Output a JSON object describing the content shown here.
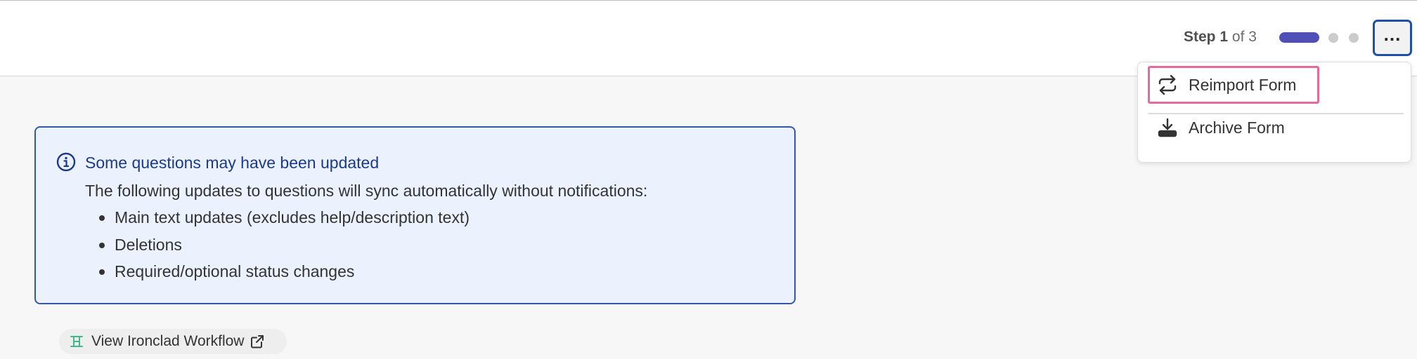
{
  "header": {
    "step": {
      "prefix": "Step",
      "current": "1",
      "suffix": "of 3",
      "current_step": 1,
      "total_steps": 3
    },
    "more_button_label": "...",
    "accent_color": "#4e4fb7"
  },
  "menu": {
    "items": [
      {
        "label": "Reimport Form",
        "icon": "reimport-icon",
        "highlighted": true
      },
      {
        "label": "Archive Form",
        "icon": "archive-icon"
      }
    ],
    "highlight_color": "#e4699d"
  },
  "callout": {
    "icon": "info-icon",
    "title": "Some questions may have been updated",
    "text": "The following updates to questions will sync automatically without notifications:",
    "items": [
      "Main text updates (excludes help/description text)",
      "Deletions",
      "Required/optional status changes"
    ],
    "border_color": "#3358a8",
    "background_color": "#ebf2fd"
  },
  "workflow_link": {
    "label": "View Ironclad Workflow",
    "icon": "ironclad-workflow-icon",
    "trailing_icon": "external-link-icon",
    "icon_color": "#3fb88a"
  }
}
